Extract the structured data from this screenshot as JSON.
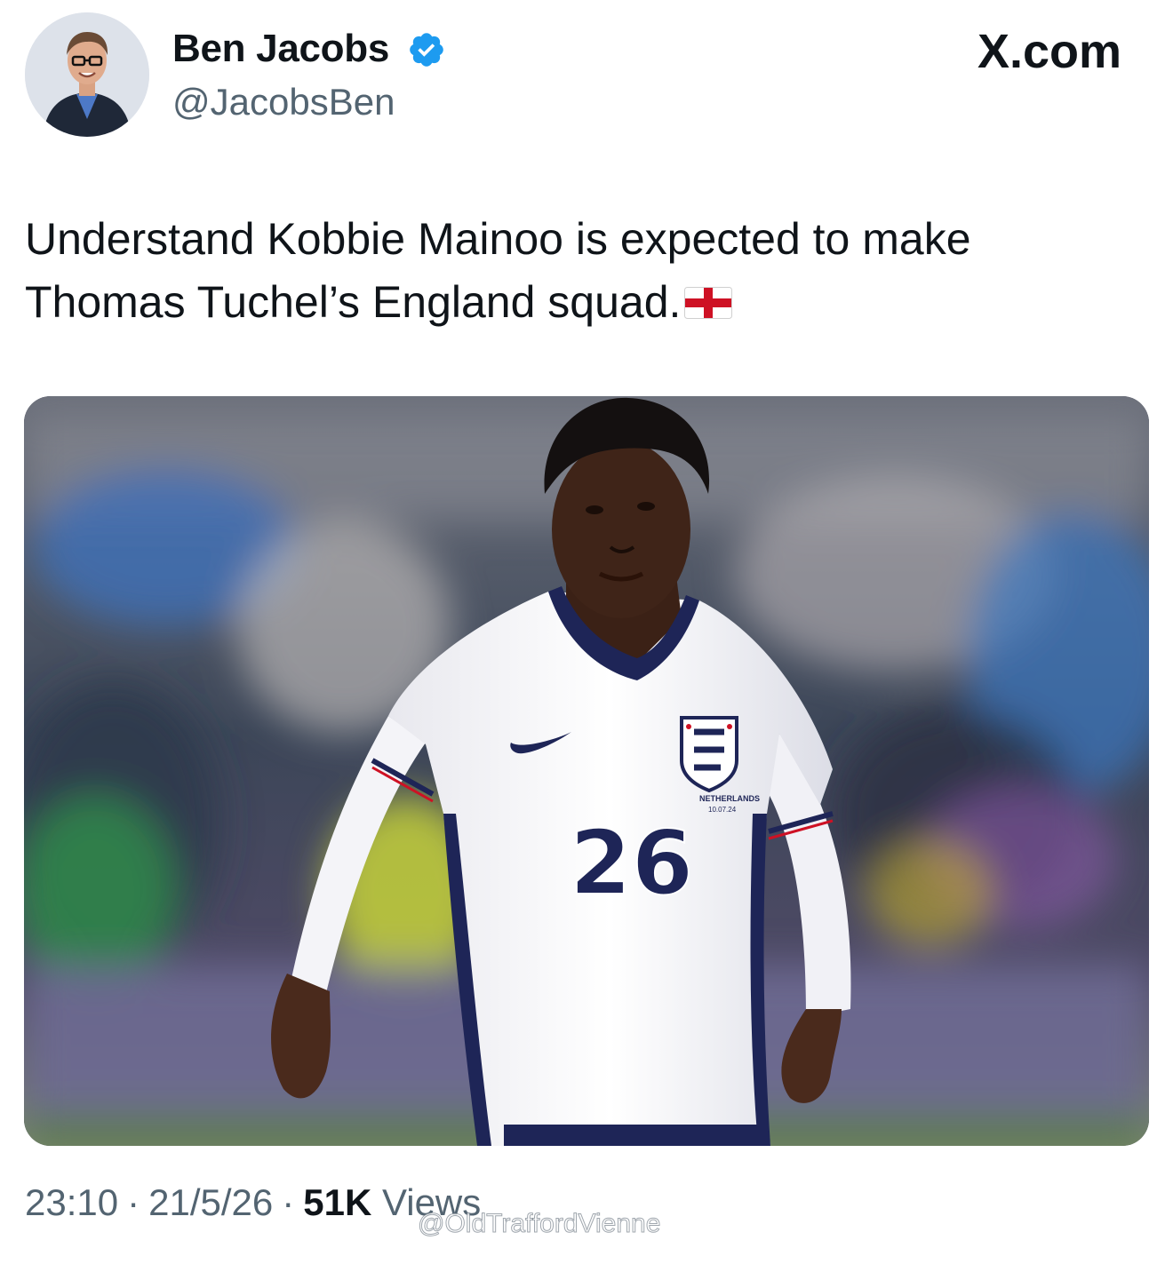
{
  "author": {
    "name": "Ben Jacobs",
    "handle": "@JacobsBen",
    "verified": true,
    "avatar_icon": "profile-photo"
  },
  "site": {
    "label": "X.com"
  },
  "tweet": {
    "text_line_1": "Understand Kobbie Mainoo is expected to make",
    "text_line_2": "Thomas Tuchel’s England squad.",
    "emoji": "england-flag-icon"
  },
  "media": {
    "shirt_number": "26",
    "shirt_patch_line_1": "NETHERLANDS",
    "shirt_patch_line_2": "10.07.24"
  },
  "meta": {
    "time": "23:10",
    "date": "21/5/26",
    "views_count": "51K",
    "views_label": "Views",
    "separator": "·"
  },
  "watermark": {
    "text": "@OldTraffordVienne"
  },
  "colors": {
    "text_primary": "#0f1419",
    "text_secondary": "#536471",
    "verified_blue": "#1d9bf0",
    "england_red": "#ce1124",
    "kit_navy": "#1e2557"
  }
}
